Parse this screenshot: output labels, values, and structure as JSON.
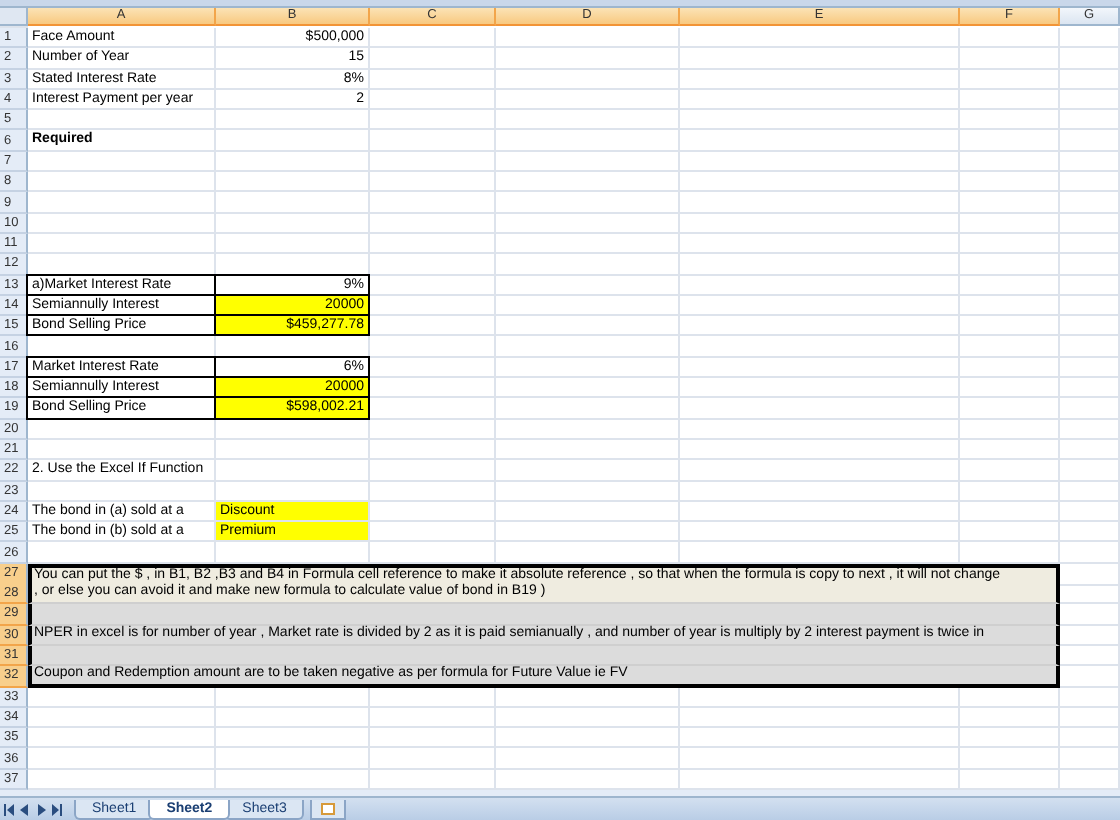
{
  "columns": [
    {
      "label": "A",
      "selected": true
    },
    {
      "label": "B",
      "selected": true
    },
    {
      "label": "C",
      "selected": true
    },
    {
      "label": "D",
      "selected": true
    },
    {
      "label": "E",
      "selected": true
    },
    {
      "label": "F",
      "selected": true
    },
    {
      "label": "G",
      "selected": false
    }
  ],
  "rows": [
    {
      "number": "1",
      "kind": "pair",
      "selected": false,
      "a": "Face Amount",
      "b": {
        "text": "$500,000",
        "kind": "number",
        "highlighted": false
      },
      "boxed": false
    },
    {
      "number": "2",
      "kind": "pair",
      "selected": false,
      "a": "Number of Year",
      "b": {
        "text": "15",
        "kind": "number",
        "highlighted": false
      },
      "boxed": false
    },
    {
      "number": "3",
      "kind": "pair",
      "selected": false,
      "a": "Stated Interest Rate",
      "b": {
        "text": "8%",
        "kind": "number",
        "highlighted": false
      },
      "boxed": false
    },
    {
      "number": "4",
      "kind": "pair",
      "selected": false,
      "a": "Interest Payment per year",
      "b": {
        "text": "2",
        "kind": "number",
        "highlighted": false
      },
      "boxed": false
    },
    {
      "number": "5",
      "kind": "blank",
      "selected": false
    },
    {
      "number": "6",
      "kind": "heading",
      "selected": false,
      "a": "Required"
    },
    {
      "number": "7",
      "kind": "blank",
      "selected": false
    },
    {
      "number": "8",
      "kind": "blank",
      "selected": false
    },
    {
      "number": "9",
      "kind": "blank",
      "selected": false
    },
    {
      "number": "10",
      "kind": "blank",
      "selected": false
    },
    {
      "number": "11",
      "kind": "blank",
      "selected": false
    },
    {
      "number": "12",
      "kind": "blank",
      "selected": false
    },
    {
      "number": "13",
      "kind": "pair",
      "selected": false,
      "a": "a)Market Interest Rate",
      "b": {
        "text": "9%",
        "kind": "number",
        "highlighted": false
      },
      "boxed": true
    },
    {
      "number": "14",
      "kind": "pair",
      "selected": false,
      "a": "Semiannully Interest",
      "b": {
        "text": "20000",
        "kind": "number",
        "highlighted": true
      },
      "boxed": true
    },
    {
      "number": "15",
      "kind": "pair",
      "selected": false,
      "a": "Bond Selling Price",
      "b": {
        "text": "$459,277.78",
        "kind": "number",
        "highlighted": true
      },
      "boxed": true
    },
    {
      "number": "16",
      "kind": "blank",
      "selected": false
    },
    {
      "number": "17",
      "kind": "pair",
      "selected": false,
      "a": "Market Interest Rate",
      "b": {
        "text": "6%",
        "kind": "number",
        "highlighted": false
      },
      "boxed": true
    },
    {
      "number": "18",
      "kind": "pair",
      "selected": false,
      "a": "Semiannully Interest",
      "b": {
        "text": "20000",
        "kind": "number",
        "highlighted": true
      },
      "boxed": true
    },
    {
      "number": "19",
      "kind": "pair",
      "selected": false,
      "a": "Bond Selling Price",
      "b": {
        "text": "$598,002.21",
        "kind": "number",
        "highlighted": true
      },
      "boxed": true
    },
    {
      "number": "20",
      "kind": "blank",
      "selected": false
    },
    {
      "number": "21",
      "kind": "blank",
      "selected": false
    },
    {
      "number": "22",
      "kind": "heading-plain",
      "selected": false,
      "a": "2. Use the Excel If Function"
    },
    {
      "number": "23",
      "kind": "blank",
      "selected": false
    },
    {
      "number": "24",
      "kind": "pair",
      "selected": false,
      "a": "The bond in (a) sold at a",
      "b": {
        "text": "Discount",
        "kind": "text",
        "highlighted": true
      },
      "boxed": false
    },
    {
      "number": "25",
      "kind": "pair",
      "selected": false,
      "a": "The bond in (b) sold at a",
      "b": {
        "text": "Premium",
        "kind": "text",
        "highlighted": true
      },
      "boxed": false
    },
    {
      "number": "26",
      "kind": "blank",
      "selected": false
    },
    {
      "number": "27",
      "kind": "note",
      "selected": true,
      "active": true,
      "text": "You can put the $ , in B1, B2 ,B3 and B4 in Formula cell reference to make it absolute reference , so that when the formula is copy to next , it will not change"
    },
    {
      "number": "28",
      "kind": "note",
      "selected": true,
      "active": true,
      "text": ", or else you can avoid it and make new formula to calculate value of bond in B19 )"
    },
    {
      "number": "29",
      "kind": "note",
      "selected": true,
      "active": false
    },
    {
      "number": "30",
      "kind": "note",
      "selected": true,
      "active": false,
      "text": "NPER in excel is for number of year , Market rate is divided by 2 as it is paid semianually , and number of year is multiply by 2  interest payment is twice in"
    },
    {
      "number": "31",
      "kind": "note",
      "selected": true,
      "active": false
    },
    {
      "number": "32",
      "kind": "note",
      "selected": true,
      "active": false,
      "text": "Coupon and Redemption amount are to be taken negative as per formula for Future Value ie FV"
    },
    {
      "number": "33",
      "kind": "blank",
      "selected": false
    },
    {
      "number": "34",
      "kind": "blank",
      "selected": false
    },
    {
      "number": "35",
      "kind": "blank",
      "selected": false
    },
    {
      "number": "36",
      "kind": "blank",
      "selected": false
    },
    {
      "number": "37",
      "kind": "blank",
      "selected": false
    }
  ],
  "sheets": [
    {
      "label": "Sheet1",
      "selected": false
    },
    {
      "label": "Sheet2",
      "selected": true
    },
    {
      "label": "Sheet3",
      "selected": false
    }
  ]
}
